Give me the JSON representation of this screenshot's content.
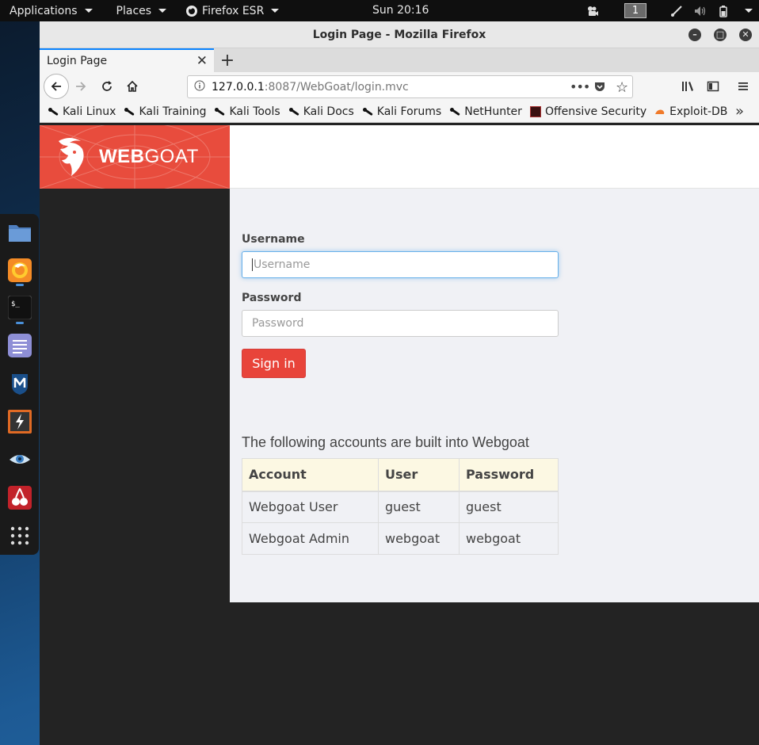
{
  "topbar": {
    "applications": "Applications",
    "places": "Places",
    "firefox": "Firefox ESR",
    "clock": "Sun 20:16",
    "workspace": "1"
  },
  "window": {
    "title": "Login Page - Mozilla Firefox"
  },
  "tab": {
    "label": "Login Page"
  },
  "urlbar": {
    "host": "127.0.0.1",
    "rest": ":8087/WebGoat/login.mvc"
  },
  "bookmarks": [
    {
      "label": "Kali Linux"
    },
    {
      "label": "Kali Training"
    },
    {
      "label": "Kali Tools"
    },
    {
      "label": "Kali Docs"
    },
    {
      "label": "Kali Forums"
    },
    {
      "label": "NetHunter"
    },
    {
      "label": "Offensive Security"
    },
    {
      "label": "Exploit-DB"
    }
  ],
  "brand": {
    "strong": "WEB",
    "light": "GOAT"
  },
  "login": {
    "username_label": "Username",
    "username_placeholder": "Username",
    "password_label": "Password",
    "password_placeholder": "Password",
    "signin": "Sign in"
  },
  "accounts": {
    "title": "The following accounts are built into Webgoat",
    "headers": [
      "Account",
      "User",
      "Password"
    ],
    "rows": [
      [
        "Webgoat User",
        "guest",
        "guest"
      ],
      [
        "Webgoat Admin",
        "webgoat",
        "webgoat"
      ]
    ]
  },
  "colors": {
    "accent": "#e8443a",
    "brand_bg": "#e84c3d",
    "page_bg": "#f0f1f5",
    "table_header_bg": "#fcf8e3"
  }
}
